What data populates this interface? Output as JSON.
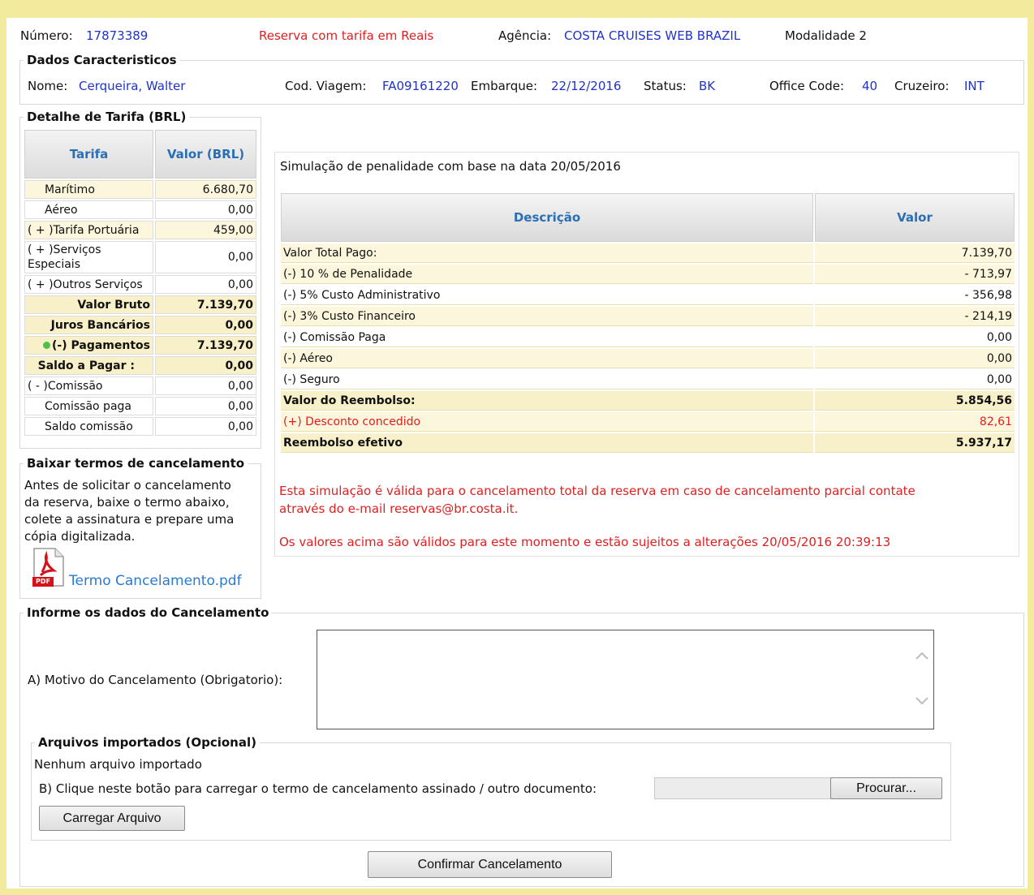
{
  "header": {
    "numero_label": "Número:",
    "numero_value": "17873389",
    "reserva_info": "Reserva com tarifa em Reais",
    "agencia_label": "Agência:",
    "agencia_value": "COSTA CRUISES WEB BRAZIL",
    "modalidade": "Modalidade 2"
  },
  "dados": {
    "legend": "Dados Caracteristicos",
    "nome_label": "Nome:",
    "nome_value": "Cerqueira, Walter",
    "cod_viagem_label": "Cod. Viagem:",
    "cod_viagem_value": "FA09161220",
    "embarque_label": "Embarque:",
    "embarque_value": "22/12/2016",
    "status_label": "Status:",
    "status_value": "BK",
    "office_label": "Office Code:",
    "office_value": "40",
    "cruzeiro_label": "Cruzeiro:",
    "cruzeiro_value": "INT"
  },
  "tarifa": {
    "legend": "Detalhe de Tarifa (BRL)",
    "col_tarifa": "Tarifa",
    "col_valor": "Valor (BRL)",
    "rows": [
      {
        "label": "Marítimo",
        "value": "6.680,70"
      },
      {
        "label": "Aéreo",
        "value": "0,00"
      },
      {
        "label": "( + )Tarifa Portuária",
        "value": "459,00"
      },
      {
        "label": "( + )Serviços Especiais",
        "value": "0,00"
      },
      {
        "label": "( + )Outros Serviços",
        "value": "0,00"
      },
      {
        "label": "Valor Bruto",
        "value": "7.139,70"
      },
      {
        "label": "Juros Bancários",
        "value": "0,00"
      },
      {
        "label": "(-) Pagamentos",
        "value": "7.139,70"
      },
      {
        "label": "Saldo a Pagar :",
        "value": "0,00"
      },
      {
        "label": "( - )Comissão",
        "value": "0,00"
      },
      {
        "label": "Comissão paga",
        "value": "0,00"
      },
      {
        "label": "Saldo comissão",
        "value": "0,00"
      }
    ]
  },
  "simulacao": {
    "title": "Simulação de penalidade com base na data 20/05/2016",
    "col_descricao": "Descrição",
    "col_valor": "Valor",
    "rows": [
      {
        "label": "Valor Total Pago:",
        "value": "7.139,70"
      },
      {
        "label": "(-) 10 % de Penalidade",
        "value": "- 713,97"
      },
      {
        "label": "(-) 5% Custo Administrativo",
        "value": "- 356,98"
      },
      {
        "label": "(-) 3% Custo Financeiro",
        "value": "- 214,19"
      },
      {
        "label": "(-) Comissão Paga",
        "value": "0,00"
      },
      {
        "label": "(-) Aéreo",
        "value": "0,00"
      },
      {
        "label": "(-) Seguro",
        "value": "0,00"
      },
      {
        "label": "Valor do Reembolso:",
        "value": "5.854,56"
      },
      {
        "label": "(+) Desconto concedido",
        "value": "82,61"
      },
      {
        "label": "Reembolso efetivo",
        "value": "5.937,17"
      }
    ],
    "note1_line1": "Esta simulação é válida para o cancelamento total da reserva em caso de cancelamento parcial contate",
    "note1_line2": "através do e-mail reservas@br.costa.it.",
    "note2": "Os valores acima são válidos para este momento e estão sujeitos a alterações 20/05/2016 20:39:13"
  },
  "baixar": {
    "legend": "Baixar termos de cancelamento",
    "text_line1": "Antes de solicitar o cancelamento",
    "text_line2": "da reserva, baixe o termo abaixo,",
    "text_line3": "colete a assinatura e prepare uma",
    "text_line4": "cópia digitalizada.",
    "link": "Termo Cancelamento.pdf",
    "pdf_badge": "PDF"
  },
  "cancelamento": {
    "legend": "Informe os dados do Cancelamento",
    "motivo_label": "A) Motivo do Cancelamento (Obrigatorio):",
    "motivo_value": "",
    "arquivos_legend": "Arquivos importados (Opcional)",
    "nenhum": "Nenhum arquivo importado",
    "upload_label": "B) Clique neste botão para carregar o termo de cancelamento assinado / outro documento:",
    "procurar": "Procurar...",
    "carregar": "Carregar Arquivo",
    "confirmar": "Confirmar Cancelamento"
  }
}
